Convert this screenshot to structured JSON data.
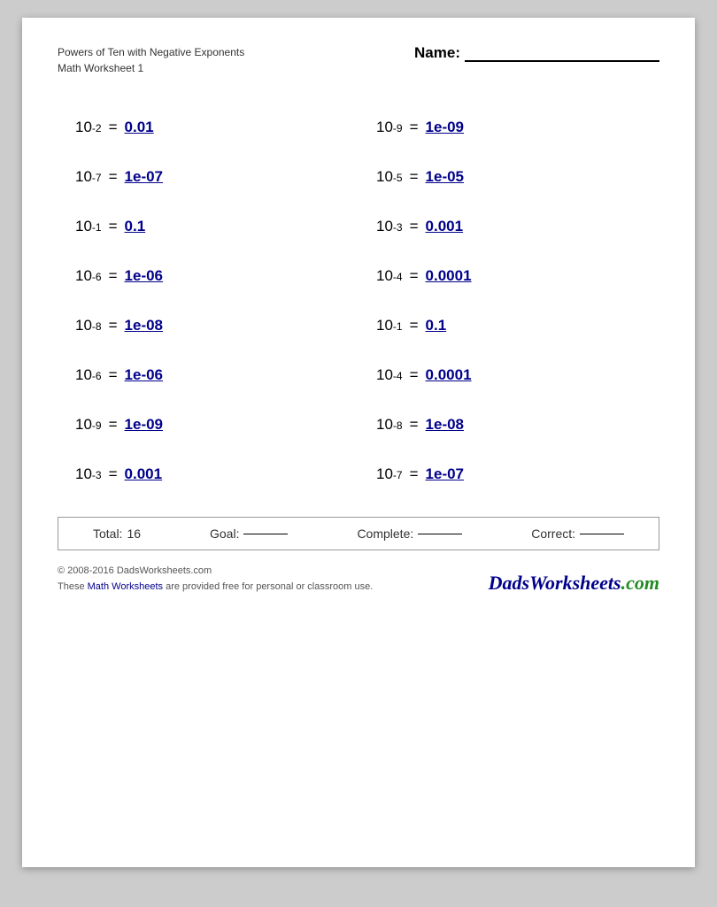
{
  "header": {
    "title_line1": "Powers of Ten with Negative Exponents",
    "title_line2": "Math Worksheet 1",
    "name_label": "Name:"
  },
  "problems": [
    {
      "base": "10",
      "exp": "-2",
      "answer": "0.01"
    },
    {
      "base": "10",
      "exp": "-9",
      "answer": "1e-09"
    },
    {
      "base": "10",
      "exp": "-7",
      "answer": "1e-07"
    },
    {
      "base": "10",
      "exp": "-5",
      "answer": "1e-05"
    },
    {
      "base": "10",
      "exp": "-1",
      "answer": "0.1"
    },
    {
      "base": "10",
      "exp": "-3",
      "answer": "0.001"
    },
    {
      "base": "10",
      "exp": "-6",
      "answer": "1e-06"
    },
    {
      "base": "10",
      "exp": "-4",
      "answer": "0.0001"
    },
    {
      "base": "10",
      "exp": "-8",
      "answer": "1e-08"
    },
    {
      "base": "10",
      "exp": "-1",
      "answer": "0.1"
    },
    {
      "base": "10",
      "exp": "-6",
      "answer": "1e-06"
    },
    {
      "base": "10",
      "exp": "-4",
      "answer": "0.0001"
    },
    {
      "base": "10",
      "exp": "-9",
      "answer": "1e-09"
    },
    {
      "base": "10",
      "exp": "-8",
      "answer": "1e-08"
    },
    {
      "base": "10",
      "exp": "-3",
      "answer": "0.001"
    },
    {
      "base": "10",
      "exp": "-7",
      "answer": "1e-07"
    }
  ],
  "footer": {
    "total_label": "Total:",
    "total_value": "16",
    "goal_label": "Goal:",
    "complete_label": "Complete:",
    "correct_label": "Correct:"
  },
  "copyright": {
    "line1": "© 2008-2016 DadsWorksheets.com",
    "line2_start": "These ",
    "line2_link": "Math Worksheets",
    "line2_end": " are provided free for personal or classroom use.",
    "brand": "DadsWorksheets.com"
  }
}
